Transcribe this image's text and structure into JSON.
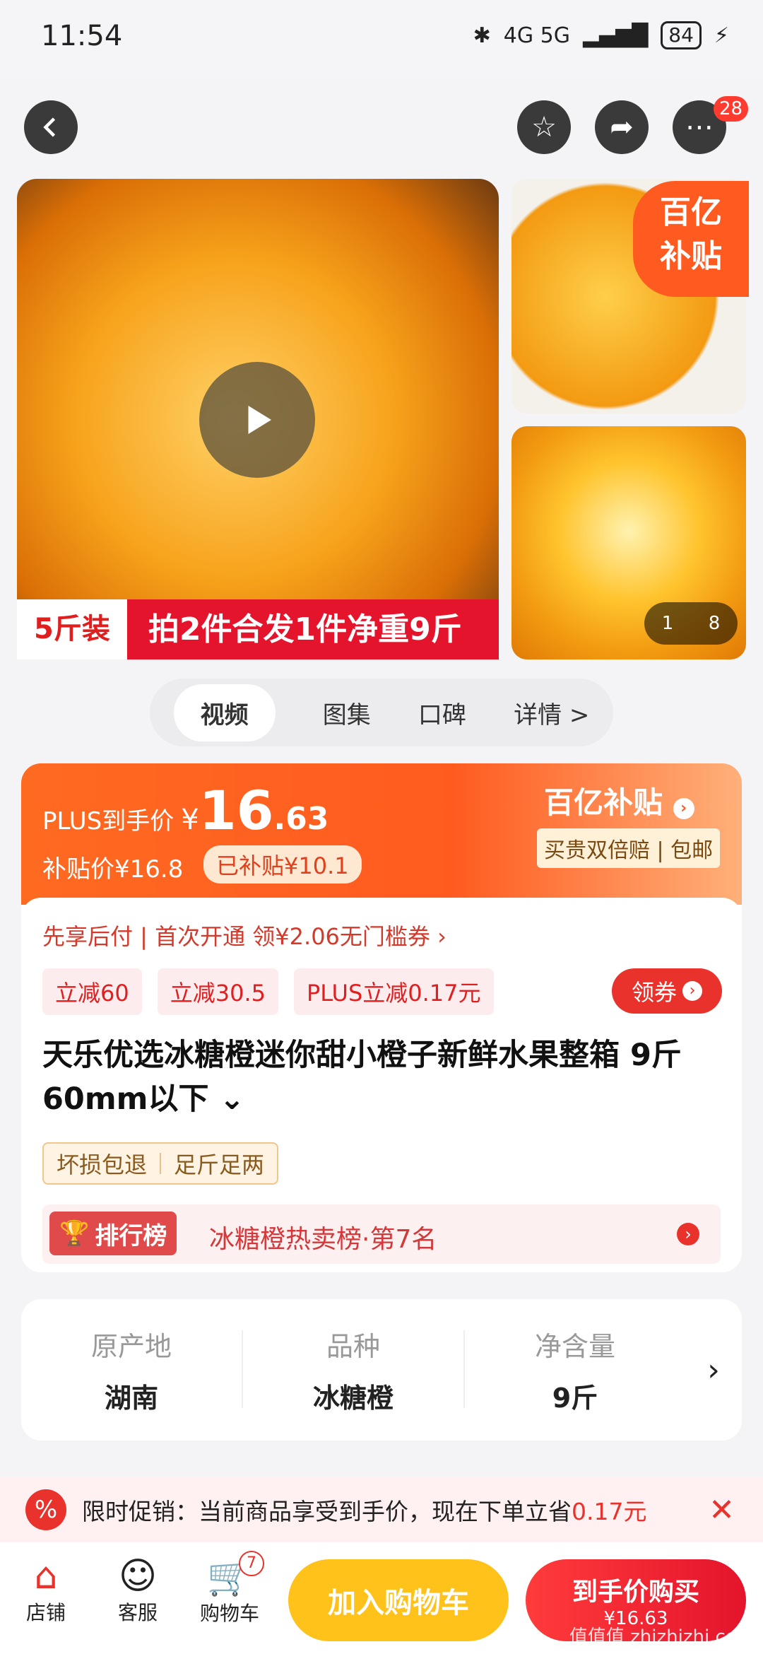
{
  "status_bar": {
    "time": "11:54",
    "network": "4G 5G",
    "battery": "84"
  },
  "nav": {
    "notification_count": "28"
  },
  "gallery": {
    "promo_left": "5斤装",
    "promo_right": "拍2件合发1件净重9斤",
    "subsidy_badge_line1": "百亿",
    "subsidy_badge_line2": "补贴",
    "page_current": "1",
    "page_total": "8"
  },
  "tabs": [
    "视频",
    "图集",
    "口碑",
    "详情 >"
  ],
  "price": {
    "plus_label": "PLUS到手价",
    "currency": "¥",
    "amount_int": "16",
    "amount_dec": ".63",
    "subsidy_price": "补贴价¥16.8",
    "subsidized": "已补贴¥10.1",
    "brand_logo": "百亿补贴",
    "brand_sub": "买贵双倍赔 | 包邮"
  },
  "credit_line": "先享后付 | 首次开通 领¥2.06无门槛券 ›",
  "coupons": [
    "立减60",
    "立减30.5",
    "PLUS立减0.17元"
  ],
  "coupon_button": "领券",
  "product_title": "天乐优选冰糖橙迷你甜小橙子新鲜水果整箱 9斤60mm以下 ⌄",
  "services": [
    "坏损包退",
    "足斤足两"
  ],
  "rank": {
    "tag": "排行榜",
    "text": "冰糖橙热卖榜·第7名"
  },
  "specs": [
    {
      "k": "原产地",
      "v": "湖南"
    },
    {
      "k": "品种",
      "v": "冰糖橙"
    },
    {
      "k": "净含量",
      "v": "9斤"
    }
  ],
  "notice": {
    "prefix": "限时促销：当前商品享受到手价，现在下单立省",
    "amount": "0.17元"
  },
  "bottom": {
    "shop": "店铺",
    "service": "客服",
    "cart": "购物车",
    "cart_count": "7",
    "add_cart": "加入购物车",
    "buy_label": "到手价购买",
    "buy_price": "¥16.63"
  },
  "watermark": "值值值 zhizhizhi.com",
  "colors": {
    "accent": "#e4142c",
    "orange": "#ff6a21",
    "yellow": "#ffc21a"
  }
}
